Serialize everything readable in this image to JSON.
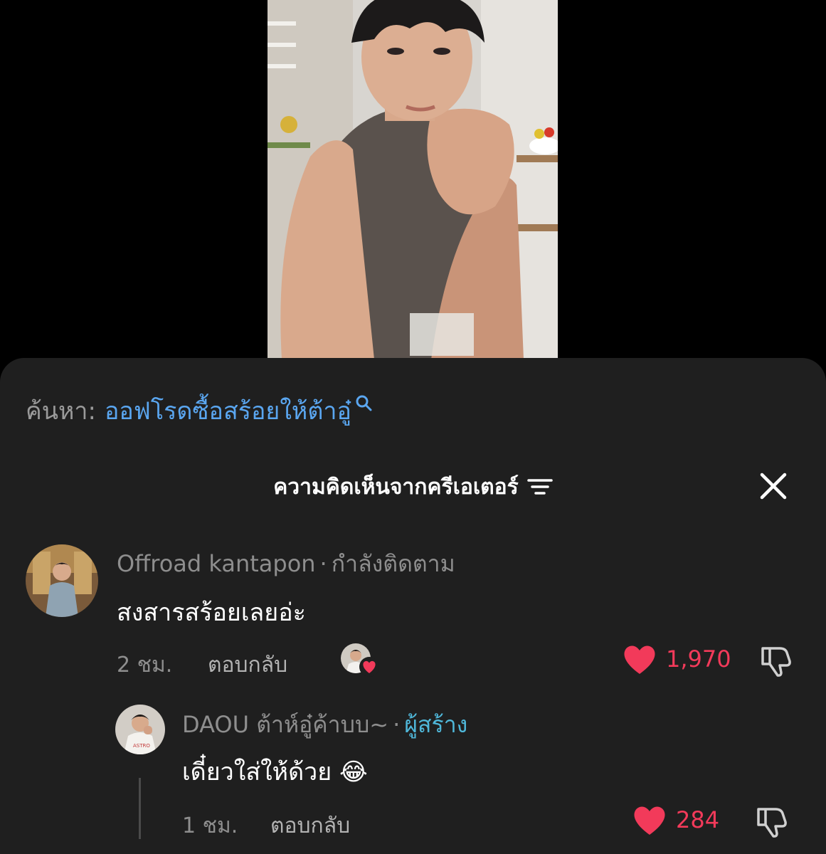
{
  "search": {
    "prefix": "ค้นหา:",
    "query": "ออฟโรดซื้อสร้อยให้ต้าอู๋"
  },
  "panel": {
    "title": "ความคิดเห็นจากครีเอเตอร์"
  },
  "comment": {
    "author": "Offroad kantapon",
    "separator": "·",
    "relation": "กำลังติดตาม",
    "text": "สงสารสร้อยเลยอ่ะ",
    "time": "2 ชม.",
    "reply_label": "ตอบกลับ",
    "likes": "1,970"
  },
  "reply": {
    "author": "DAOU ต้าห์อู๋ค้าบบ~",
    "separator": "·",
    "badge": "ผู้สร้าง",
    "text": "เดี๋ยวใส่ให้ด้วย",
    "emoji": "😂",
    "time": "1 ชม.",
    "reply_label": "ตอบกลับ",
    "likes": "284"
  },
  "colors": {
    "sheet_bg": "#1f1f1f",
    "link_blue": "#5aa6f0",
    "creator_badge": "#4fb7d9",
    "like_red": "#f23a5a"
  }
}
